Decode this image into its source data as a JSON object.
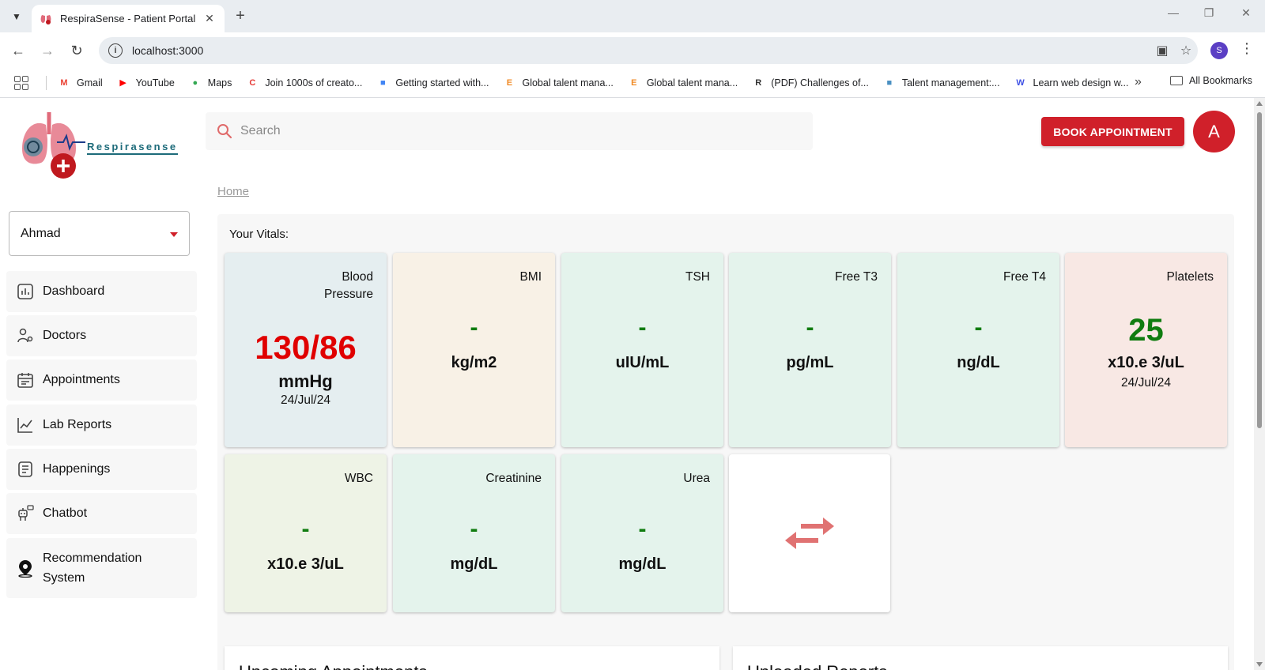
{
  "browser": {
    "tab_title": "RespiraSense - Patient Portal",
    "url": "localhost:3000",
    "profile_initial": "S",
    "bookmarks": [
      {
        "label": "Gmail",
        "icon": "gmail-icon",
        "color": "#ea4335"
      },
      {
        "label": "YouTube",
        "icon": "youtube-icon",
        "color": "#ff0000"
      },
      {
        "label": "Maps",
        "icon": "maps-icon",
        "color": "#34a853"
      },
      {
        "label": "Join 1000s of creato...",
        "icon": "creator-icon",
        "color": "#e53935"
      },
      {
        "label": "Getting started with...",
        "icon": "folder-blue-icon",
        "color": "#4285f4"
      },
      {
        "label": "Global talent mana...",
        "icon": "e-icon",
        "color": "#f08a24"
      },
      {
        "label": "Global talent mana...",
        "icon": "e-icon",
        "color": "#f08a24"
      },
      {
        "label": "(PDF) Challenges of...",
        "icon": "researchgate-icon",
        "color": "#333333"
      },
      {
        "label": "Talent management:...",
        "icon": "image-icon",
        "color": "#4a90c2"
      },
      {
        "label": "Learn web design w...",
        "icon": "w-icon",
        "color": "#3f51e5"
      }
    ],
    "all_bookmarks": "All Bookmarks"
  },
  "app": {
    "logo_text": "Respirasense",
    "search_placeholder": "Search",
    "book_button": "BOOK APPOINTMENT",
    "avatar_initial": "A",
    "patient": "Ahmad",
    "nav": [
      {
        "label": "Dashboard",
        "icon": "dashboard-icon"
      },
      {
        "label": "Doctors",
        "icon": "doctors-icon"
      },
      {
        "label": "Appointments",
        "icon": "calendar-icon"
      },
      {
        "label": "Lab Reports",
        "icon": "chart-line-icon"
      },
      {
        "label": "Happenings",
        "icon": "document-icon"
      },
      {
        "label": "Chatbot",
        "icon": "robot-icon"
      },
      {
        "label": "Recommendation System",
        "icon": "location-pin-icon"
      }
    ],
    "breadcrumb": "Home",
    "vitals_title": "Your Vitals:",
    "vitals": [
      {
        "label": "Blood Pressure",
        "value": "130/86",
        "unit": "mmHg",
        "date": "24/Jul/24",
        "bg": "#e5eef0"
      },
      {
        "label": "BMI",
        "value": "-",
        "unit": "kg/m2",
        "date": "",
        "bg": "#f8f1e6"
      },
      {
        "label": "TSH",
        "value": "-",
        "unit": "uIU/mL",
        "date": "",
        "bg": "#e4f3ec"
      },
      {
        "label": "Free T3",
        "value": "-",
        "unit": "pg/mL",
        "date": "",
        "bg": "#e4f3ec"
      },
      {
        "label": "Free T4",
        "value": "-",
        "unit": "ng/dL",
        "date": "",
        "bg": "#e4f3ec"
      },
      {
        "label": "Platelets",
        "value": "25",
        "unit": "x10.e 3/uL",
        "date": "24/Jul/24",
        "bg": "#f8e8e4"
      },
      {
        "label": "WBC",
        "value": "-",
        "unit": "x10.e 3/uL",
        "date": "",
        "bg": "#eef3e6"
      },
      {
        "label": "Creatinine",
        "value": "-",
        "unit": "mg/dL",
        "date": "",
        "bg": "#e4f3ec"
      },
      {
        "label": "Urea",
        "value": "-",
        "unit": "mg/dL",
        "date": "",
        "bg": "#e4f3ec"
      }
    ],
    "swap_icon": "swap-arrows-icon",
    "bottom_cards": [
      "Upcoming Appointments",
      "Uploaded Reports"
    ]
  }
}
